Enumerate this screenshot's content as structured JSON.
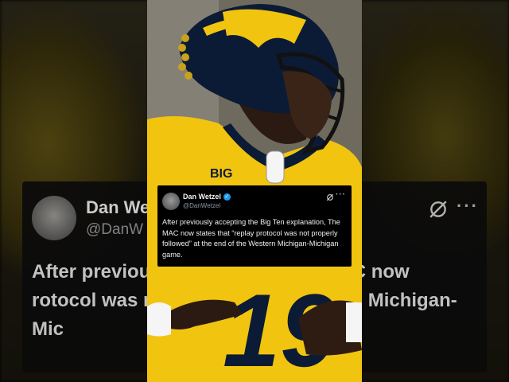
{
  "tweet": {
    "author_name": "Dan Wetzel",
    "author_handle": "@DanWetzel",
    "text": "After previously accepting the Big Ten explanation, The MAC now states that “replay protocol was not properly followed” at the end of the Western Michigan-Michigan game.",
    "more_glyph": "···"
  },
  "background_card": {
    "name": "Dan We",
    "handle": "@DanW",
    "text": "After previous                           explanation, The MAC now                           rotocol was not properly follo                            estern Michigan-Mic",
    "more_glyph": "···"
  },
  "photo": {
    "helmet_logo": "BIG",
    "jersey_number": "19"
  },
  "colors": {
    "maize": "#f1c40f",
    "navy": "#0b1b35",
    "verified_blue": "#1d9bf0"
  }
}
